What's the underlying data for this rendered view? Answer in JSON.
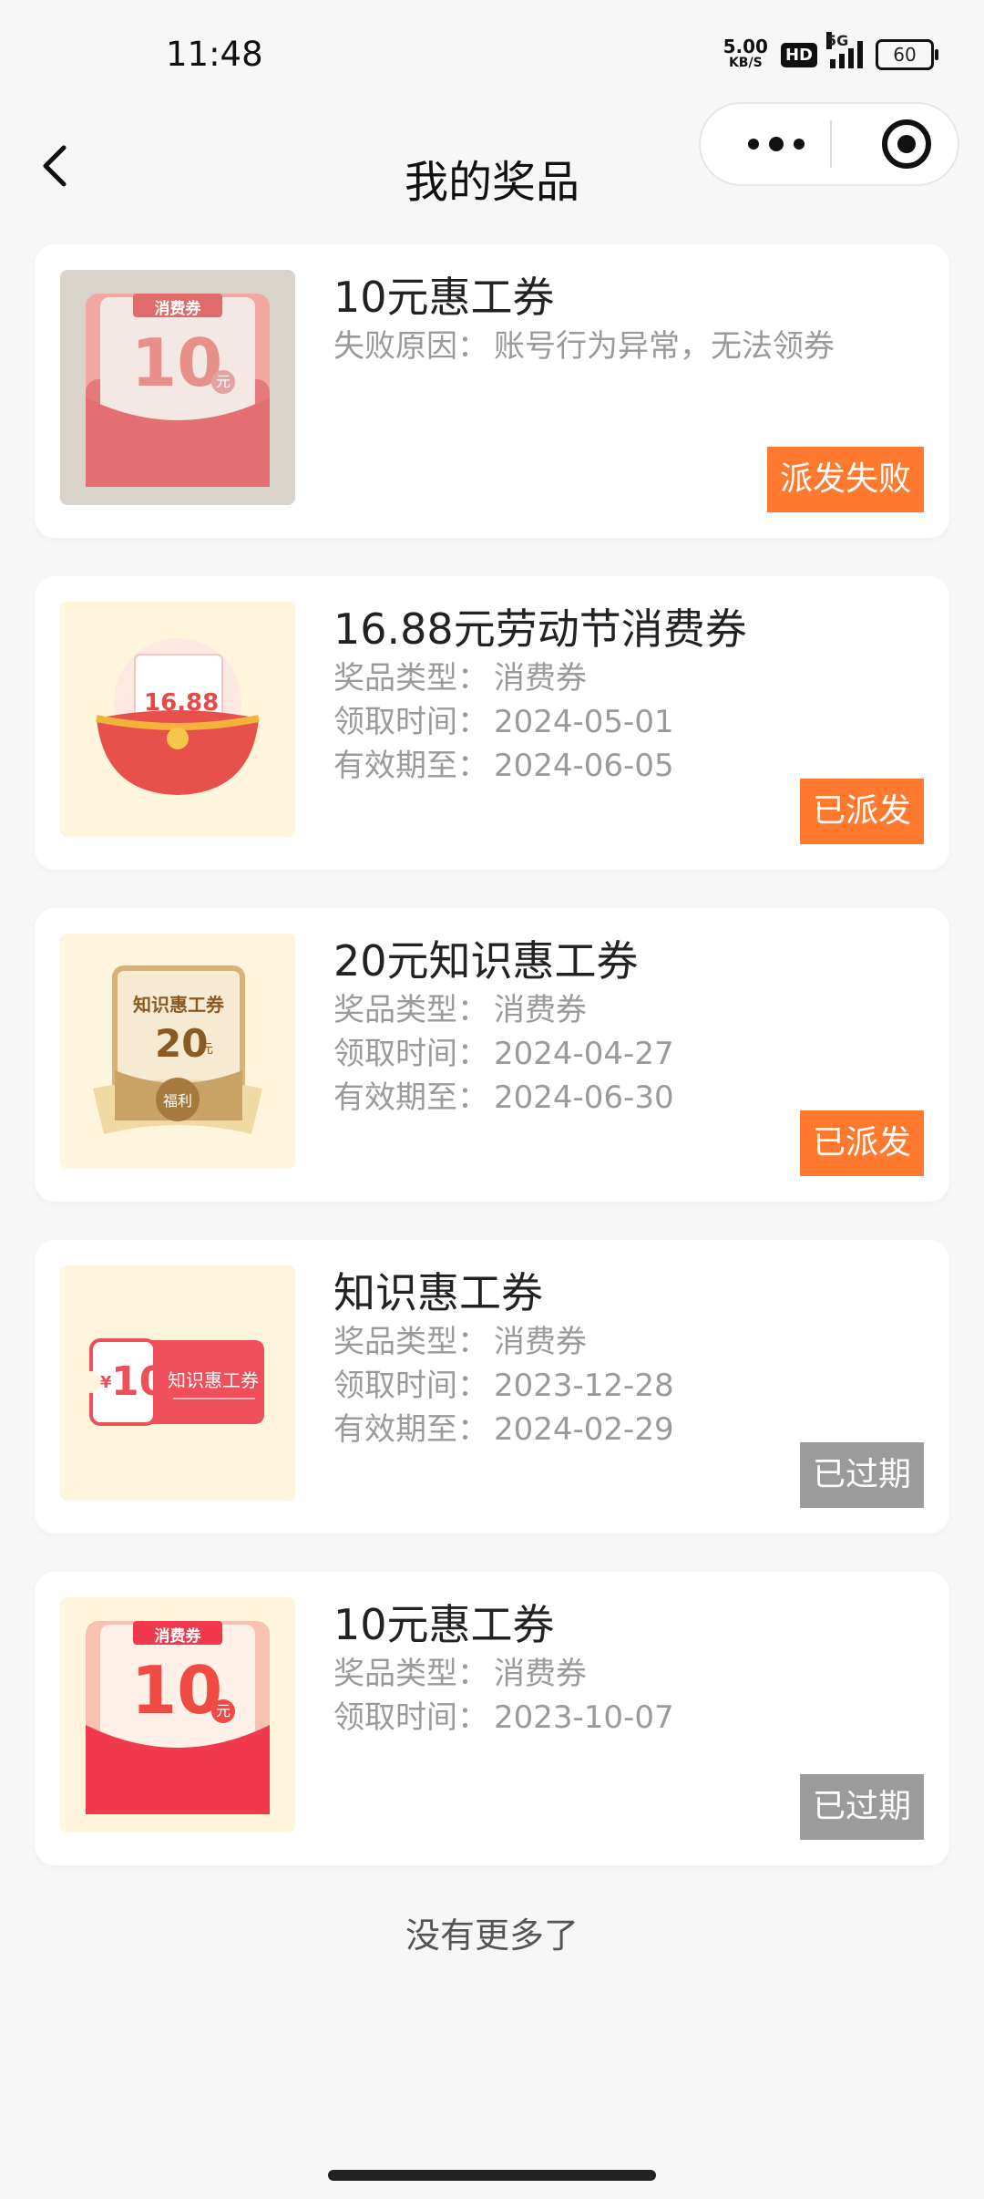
{
  "status_bar": {
    "time": "11:48",
    "speed_value": "5.00",
    "speed_unit": "KB/S",
    "hd": "HD",
    "network": "5G",
    "battery": "60"
  },
  "nav": {
    "title": "我的奖品",
    "back_icon": "chevron-left-icon",
    "more_icon": "more-dots-icon",
    "close_icon": "target-close-icon"
  },
  "prizes": [
    {
      "title": "10元惠工券",
      "lines": [
        {
          "label": "失败原因：",
          "value": "账号行为异常，无法领券"
        }
      ],
      "status": "派发失败",
      "status_color": "#ff7a2f",
      "thumb": {
        "label": "消费券",
        "amount": "10",
        "unit": "元",
        "style": "red-faded"
      }
    },
    {
      "title": "16.88元劳动节消费券",
      "lines": [
        {
          "label": "奖品类型：",
          "value": "消费券"
        },
        {
          "label": "领取时间：",
          "value": "2024-05-01"
        },
        {
          "label": "有效期至：",
          "value": "2024-06-05"
        }
      ],
      "status": "已派发",
      "status_color": "#ff7a2f",
      "thumb": {
        "label": "",
        "amount": "16.88",
        "unit": "",
        "style": "pot"
      }
    },
    {
      "title": "20元知识惠工券",
      "lines": [
        {
          "label": "奖品类型：",
          "value": "消费券"
        },
        {
          "label": "领取时间：",
          "value": "2024-04-27"
        },
        {
          "label": "有效期至：",
          "value": "2024-06-30"
        }
      ],
      "status": "已派发",
      "status_color": "#ff7a2f",
      "thumb": {
        "label": "知识惠工券",
        "amount": "20",
        "unit": "元",
        "seal": "福利",
        "style": "gold"
      }
    },
    {
      "title": "知识惠工券",
      "lines": [
        {
          "label": "奖品类型：",
          "value": "消费券"
        },
        {
          "label": "领取时间：",
          "value": "2023-12-28"
        },
        {
          "label": "有效期至：",
          "value": "2024-02-29"
        }
      ],
      "status": "已过期",
      "status_color": "#9b9b9b",
      "thumb": {
        "label": "知识惠工券",
        "amount": "10",
        "currency": "¥",
        "style": "ticket"
      }
    },
    {
      "title": "10元惠工券",
      "lines": [
        {
          "label": "奖品类型：",
          "value": "消费券"
        },
        {
          "label": "领取时间：",
          "value": "2023-10-07"
        }
      ],
      "status": "已过期",
      "status_color": "#9b9b9b",
      "thumb": {
        "label": "消费券",
        "amount": "10",
        "unit": "元",
        "style": "red"
      }
    }
  ],
  "footer": {
    "no_more": "没有更多了"
  }
}
